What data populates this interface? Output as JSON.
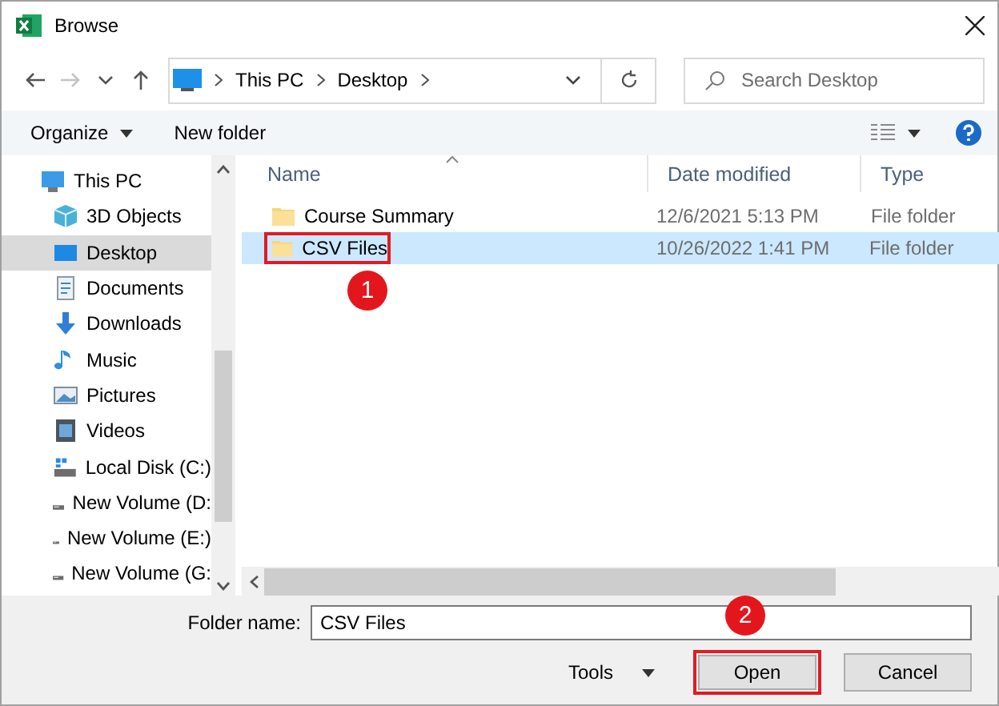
{
  "window": {
    "title": "Browse"
  },
  "nav_buttons": [
    {
      "kind": "back",
      "disabled": false
    },
    {
      "kind": "forward",
      "disabled": true
    },
    {
      "kind": "recent",
      "disabled": false
    },
    {
      "kind": "up",
      "disabled": false
    }
  ],
  "address": {
    "path": [
      "This PC",
      "Desktop"
    ]
  },
  "search": {
    "placeholder": "Search Desktop"
  },
  "toolbar": {
    "items": [
      "Organize",
      "New folder"
    ]
  },
  "sidebar": {
    "items": [
      {
        "label": "This PC",
        "kind": "pc",
        "selected": false,
        "children": [
          {
            "label": "3D Objects",
            "kind": "objects3d",
            "selected": false
          },
          {
            "label": "Desktop",
            "kind": "desktop",
            "selected": true
          },
          {
            "label": "Documents",
            "kind": "documents",
            "selected": false
          },
          {
            "label": "Downloads",
            "kind": "downloads",
            "selected": false
          },
          {
            "label": "Music",
            "kind": "music",
            "selected": false
          },
          {
            "label": "Pictures",
            "kind": "pictures",
            "selected": false
          },
          {
            "label": "Videos",
            "kind": "videos",
            "selected": false
          },
          {
            "label": "Local Disk (C:)",
            "kind": "disk",
            "selected": false
          },
          {
            "label": "New Volume (D:",
            "kind": "volume",
            "selected": false
          },
          {
            "label": "New Volume (E:)",
            "kind": "volume",
            "selected": false
          },
          {
            "label": "New Volume (G:",
            "kind": "volume",
            "selected": false
          }
        ]
      }
    ]
  },
  "files": {
    "columns": [
      "Name",
      "Date modified",
      "Type"
    ],
    "rows": [
      {
        "name": "Course Summary",
        "date": "12/6/2021 5:13 PM",
        "type": "File folder",
        "selected": false,
        "highlighted": false
      },
      {
        "name": "CSV Files",
        "date": "10/26/2022 1:41 PM",
        "type": "File folder",
        "selected": true,
        "highlighted": true,
        "badge": "1"
      }
    ]
  },
  "footer": {
    "folder_label": "Folder name:",
    "folder_value": "CSV Files",
    "buttons": [
      {
        "label": "Tools",
        "kind": "menu",
        "highlighted": false
      },
      {
        "label": "Open",
        "kind": "push",
        "highlighted": true,
        "badge": "2"
      },
      {
        "label": "Cancel",
        "kind": "push",
        "highlighted": false
      }
    ]
  }
}
